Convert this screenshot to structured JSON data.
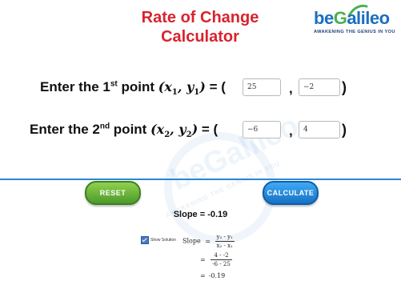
{
  "header": {
    "title_line1": "Rate of Change",
    "title_line2": "Calculator",
    "logo_be": "be",
    "logo_rest": "alileo",
    "logo_g": "G",
    "logo_tagline": "AWAKENING THE GENIUS IN YOU",
    "brand_color": "#d9232d"
  },
  "point1": {
    "label_pre": "Enter the 1",
    "label_sup": "st",
    "label_post": " point ",
    "var_x": "x",
    "var_x_sub": "1",
    "var_y": "y",
    "var_y_sub": "1",
    "equals_paren": "= (",
    "x_value": "25",
    "y_value": "−2",
    "comma": ",",
    "close_paren": ")"
  },
  "point2": {
    "label_pre": "Enter the 2",
    "label_sup": "nd",
    "label_post": " point ",
    "var_x": "x",
    "var_x_sub": "2",
    "var_y": "y",
    "var_y_sub": "2",
    "equals_paren": "= (",
    "x_value": "−6",
    "y_value": "4",
    "comma": ",",
    "close_paren": ")"
  },
  "buttons": {
    "reset_label": "RESET",
    "calculate_label": "CALCULATE",
    "reset_color": "#5aa832",
    "calculate_color": "#1f86d8"
  },
  "watermark": {
    "text": "beGalileo",
    "tagline": "AWAKENING THE GENIUS IN YOU"
  },
  "result": {
    "slope_heading": "Slope = -0.19",
    "show_solution_label": "Show Solution",
    "show_solution_checked": true,
    "step1_lhs": "Slope",
    "step1_eq": "=",
    "step1_num": "y₂ - y₁",
    "step1_den": "x₂ - x₁",
    "step2_eq": "=",
    "step2_num": "4 - -2",
    "step2_den": "-6 - 25",
    "step3_eq": "=",
    "step3_val": "-0.19"
  }
}
